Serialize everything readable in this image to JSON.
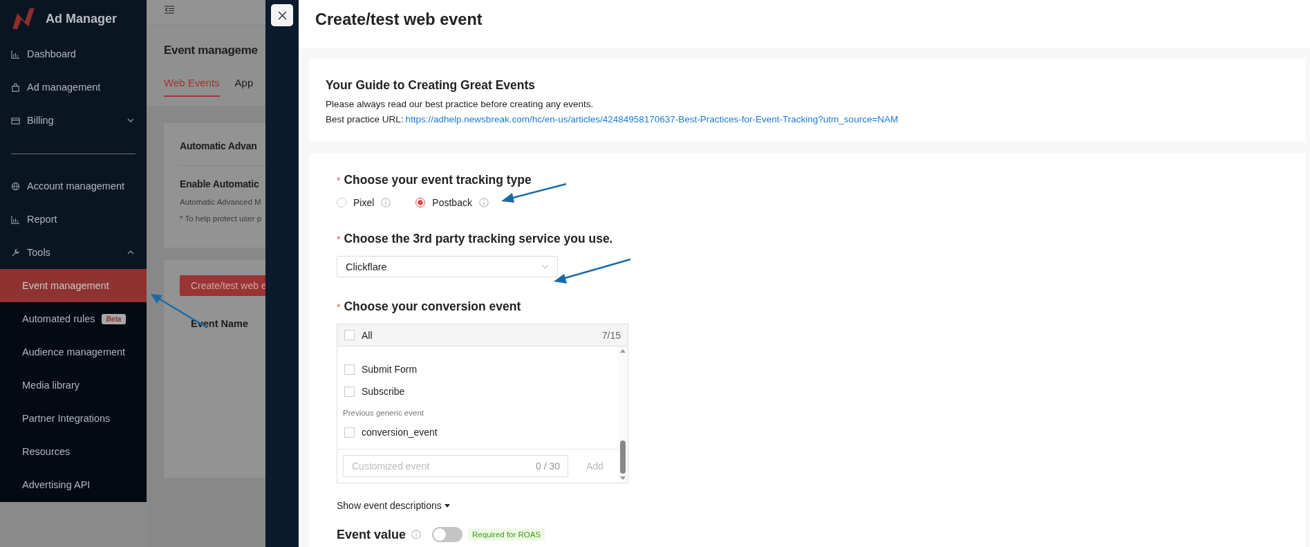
{
  "sidebar": {
    "brand": "Ad Manager",
    "items": [
      {
        "label": "Dashboard",
        "selected": false
      },
      {
        "label": "Ad management",
        "selected": false
      },
      {
        "label": "Billing",
        "selected": false,
        "expanded": false
      },
      {
        "label": "Account management",
        "selected": false
      },
      {
        "label": "Report",
        "selected": false
      },
      {
        "label": "Tools",
        "selected": false,
        "expanded": true,
        "children": [
          {
            "label": "Event management",
            "selected": true
          },
          {
            "label": "Automated rules",
            "selected": false,
            "badge": "Beta"
          },
          {
            "label": "Audience management",
            "selected": false
          },
          {
            "label": "Media library",
            "selected": false
          },
          {
            "label": "Partner Integrations",
            "selected": false
          },
          {
            "label": "Resources",
            "selected": false
          },
          {
            "label": "Advertising API",
            "selected": false
          }
        ]
      }
    ]
  },
  "background_page": {
    "title": "Event manageme",
    "tabs": [
      {
        "label": "Web Events",
        "selected": true
      },
      {
        "label": "App",
        "selected": false
      }
    ],
    "card": {
      "title": "Automatic Advan",
      "subtitle": "Enable Automatic",
      "description": "Automatic Advanced M",
      "note": "* To help protect user p"
    },
    "create_button": "Create/test web e",
    "table_column": "Event Name"
  },
  "drawer": {
    "title": "Create/test web event",
    "guide": {
      "title": "Your Guide to Creating Great Events",
      "text": "Please always read our best practice before creating any events.",
      "url_label": "Best practice URL:",
      "url": "https://adhelp.newsbreak.com/hc/en-us/articles/42484958170637-Best-Practices-for-Event-Tracking?utm_source=NAM"
    },
    "tracking_type": {
      "required_mark": "*",
      "label": "Choose your event tracking type",
      "options": [
        {
          "label": "Pixel",
          "selected": false
        },
        {
          "label": "Postback",
          "selected": true
        }
      ]
    },
    "service": {
      "required_mark": "*",
      "label": "Choose the 3rd party tracking service you use.",
      "value": "Clickflare"
    },
    "conversion": {
      "required_mark": "*",
      "label": "Choose your conversion event",
      "all_label": "All",
      "all_checked": false,
      "count": "7/15",
      "items": [
        {
          "kind": "option",
          "label": "Submit Form",
          "checked": false
        },
        {
          "kind": "option",
          "label": "Subscribe",
          "checked": false
        },
        {
          "kind": "group",
          "label": "Previous generic event"
        },
        {
          "kind": "option",
          "label": "conversion_event",
          "checked": false
        }
      ],
      "custom_placeholder": "Customized event",
      "custom_counter": "0 / 30",
      "add_button": "Add"
    },
    "descriptions_toggle": "Show event descriptions",
    "event_value": {
      "label": "Event value",
      "on": false,
      "tag": "Required for ROAS"
    }
  }
}
